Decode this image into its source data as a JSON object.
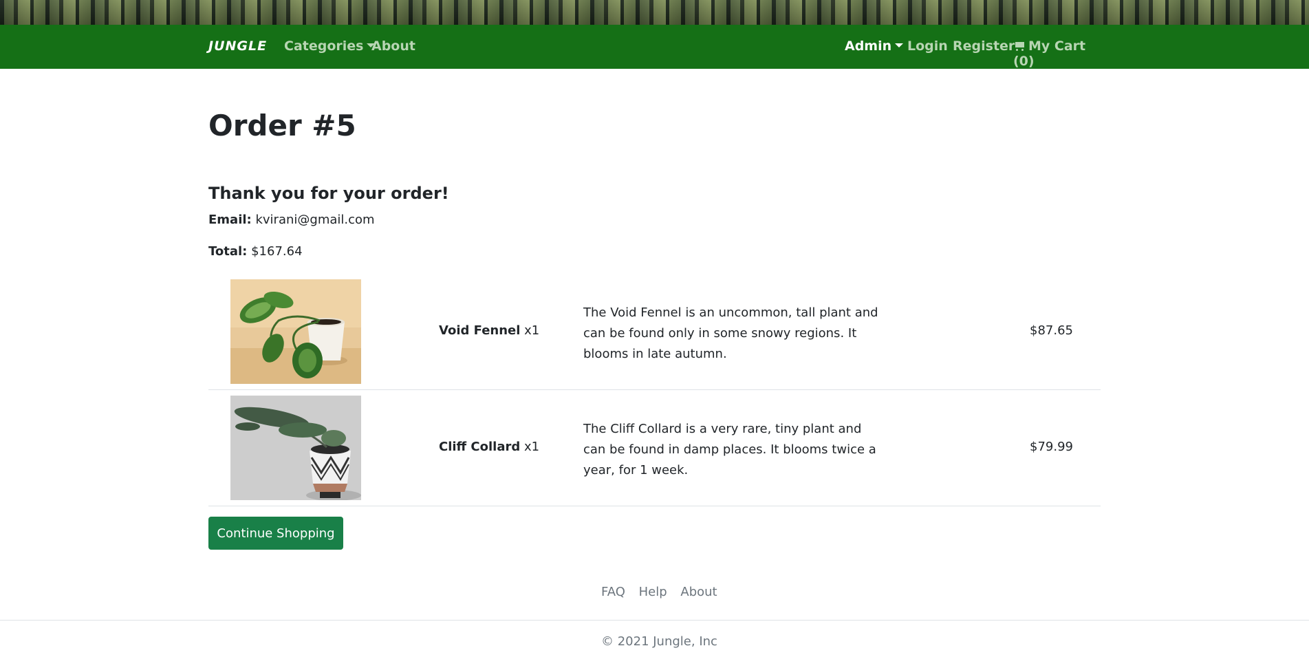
{
  "nav": {
    "brand": "JUNGLE",
    "categories": "Categories",
    "about": "About",
    "admin": "Admin",
    "login": "Login",
    "register": "Register",
    "cart": "My Cart (0)"
  },
  "order": {
    "title": "Order #5",
    "thanks": "Thank you for your order!",
    "email_label": "Email:",
    "email": "kvirani@gmail.com",
    "total_label": "Total:",
    "total": "$167.64"
  },
  "items": [
    {
      "name": "Void Fennel",
      "qty": "x1",
      "description": "The Void Fennel is an uncommon, tall plant and can be found only in some snowy regions. It blooms in late autumn.",
      "price": "$87.65"
    },
    {
      "name": "Cliff Collard",
      "qty": "x1",
      "description": "The Cliff Collard is a very rare, tiny plant and can be found in damp places. It blooms twice a year, for 1 week.",
      "price": "$79.99"
    }
  ],
  "continue_button": "Continue Shopping",
  "footer": {
    "links": [
      "FAQ",
      "Help",
      "About"
    ],
    "copyright": "© 2021 Jungle, Inc"
  }
}
